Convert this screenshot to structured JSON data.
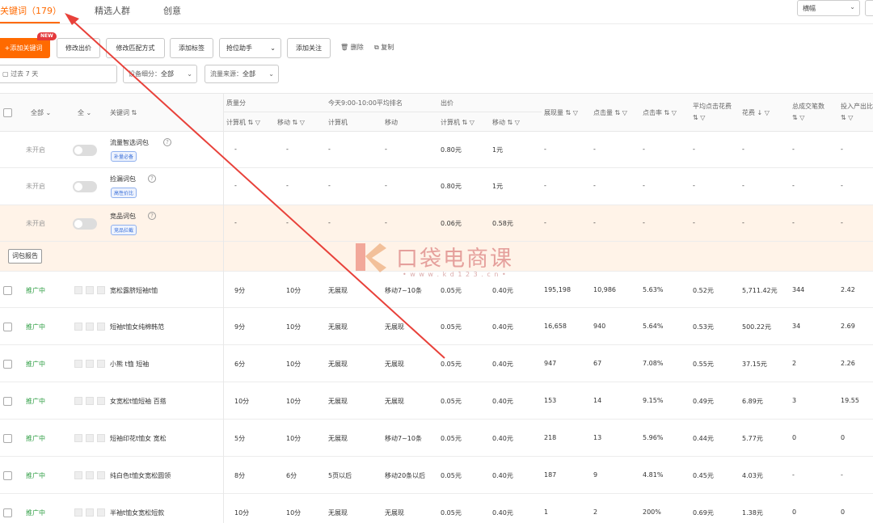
{
  "tabs": [
    {
      "label": "关键词（179）",
      "active": true
    },
    {
      "label": "精选人群",
      "active": false
    },
    {
      "label": "创意",
      "active": false
    }
  ],
  "view_select": {
    "value": "横幅"
  },
  "toolbar": {
    "add_keyword": "+添加关键词",
    "new_badge": "NEW",
    "modify_bid": "修改出价",
    "modify_match": "修改匹配方式",
    "add_tag": "添加标签",
    "rank_helper": "抢位助手",
    "add_follow": "添加关注",
    "delete": "删除",
    "copy": "复制"
  },
  "filters": {
    "date": "过去 7 天",
    "device_label": "设备细分：",
    "device_value": "全部",
    "source_label": "流量来源：",
    "source_value": "全部"
  },
  "headers": {
    "status_filter": "全部",
    "all2": "全",
    "keyword": "关键词 ⇅",
    "quality_group": "质量分",
    "quality_pc": "计算机 ⇅ ▽",
    "quality_mobile": "移动 ⇅ ▽",
    "rank_group": "今天9:00-10:00平均排名",
    "rank_pc": "计算机",
    "rank_mobile": "移动",
    "bid_group": "出价",
    "bid_pc": "计算机 ⇅ ▽",
    "bid_mobile": "移动 ⇅ ▽",
    "impressions": "展现量 ⇅ ▽",
    "clicks": "点击量 ⇅ ▽",
    "ctr": "点击率 ⇅ ▽",
    "avg_cpc_line1": "平均点击花费",
    "avg_cpc_line2": "⇅ ▽",
    "spend": "花费 ↓ ▽",
    "orders_line1": "总成交笔数",
    "orders_line2": "⇅ ▽",
    "roi_line1": "投入产出比",
    "roi_line2": "⇅ ▽"
  },
  "packages": [
    {
      "status": "未开启",
      "name": "流量智选词包",
      "tag": "补量必备",
      "q_pc": "-",
      "q_mob": "-",
      "r_pc": "-",
      "r_mob": "-",
      "bid_pc": "0.80元",
      "bid_mob": "1元",
      "imp": "-",
      "clk": "-",
      "ctr": "-",
      "cpc": "-",
      "spend": "-",
      "orders": "-",
      "roi": "-"
    },
    {
      "status": "未开启",
      "name": "捡漏词包",
      "tag": "高性价比",
      "q_pc": "-",
      "q_mob": "-",
      "r_pc": "-",
      "r_mob": "-",
      "bid_pc": "0.80元",
      "bid_mob": "1元",
      "imp": "-",
      "clk": "-",
      "ctr": "-",
      "cpc": "-",
      "spend": "-",
      "orders": "-",
      "roi": "-"
    },
    {
      "status": "未开启",
      "name": "竞品词包",
      "tag": "竞品拦截",
      "q_pc": "-",
      "q_mob": "-",
      "r_pc": "-",
      "r_mob": "-",
      "bid_pc": "0.06元",
      "bid_mob": "0.58元",
      "imp": "-",
      "clk": "-",
      "ctr": "-",
      "cpc": "-",
      "spend": "-",
      "orders": "-",
      "roi": "-"
    }
  ],
  "report_button": "词包报告",
  "keywords": [
    {
      "status": "推广中",
      "name": "宽松露脐短袖t恤",
      "q_pc": "9分",
      "q_mob": "10分",
      "r_pc": "无展现",
      "r_mob": "移动7~10条",
      "bid_pc": "0.05元",
      "bid_mob": "0.40元",
      "imp": "195,198",
      "clk": "10,986",
      "ctr": "5.63%",
      "cpc": "0.52元",
      "spend": "5,711.42元",
      "orders": "344",
      "roi": "2.42"
    },
    {
      "status": "推广中",
      "name": "短袖t恤女纯棉韩范",
      "q_pc": "9分",
      "q_mob": "10分",
      "r_pc": "无展现",
      "r_mob": "无展现",
      "bid_pc": "0.05元",
      "bid_mob": "0.40元",
      "imp": "16,658",
      "clk": "940",
      "ctr": "5.64%",
      "cpc": "0.53元",
      "spend": "500.22元",
      "orders": "34",
      "roi": "2.69"
    },
    {
      "status": "推广中",
      "name": "小熊 t恤 短袖",
      "q_pc": "6分",
      "q_mob": "10分",
      "r_pc": "无展现",
      "r_mob": "无展现",
      "bid_pc": "0.05元",
      "bid_mob": "0.40元",
      "imp": "947",
      "clk": "67",
      "ctr": "7.08%",
      "cpc": "0.55元",
      "spend": "37.15元",
      "orders": "2",
      "roi": "2.26"
    },
    {
      "status": "推广中",
      "name": "女宽松t恤短袖 百搭",
      "q_pc": "10分",
      "q_mob": "10分",
      "r_pc": "无展现",
      "r_mob": "无展现",
      "bid_pc": "0.05元",
      "bid_mob": "0.40元",
      "imp": "153",
      "clk": "14",
      "ctr": "9.15%",
      "cpc": "0.49元",
      "spend": "6.89元",
      "orders": "3",
      "roi": "19.55"
    },
    {
      "status": "推广中",
      "name": "短袖印花t恤女 宽松",
      "q_pc": "5分",
      "q_mob": "10分",
      "r_pc": "无展现",
      "r_mob": "移动7~10条",
      "bid_pc": "0.05元",
      "bid_mob": "0.40元",
      "imp": "218",
      "clk": "13",
      "ctr": "5.96%",
      "cpc": "0.44元",
      "spend": "5.77元",
      "orders": "0",
      "roi": "0"
    },
    {
      "status": "推广中",
      "name": "纯白色t恤女宽松圆领",
      "q_pc": "8分",
      "q_mob": "6分",
      "r_pc": "5页以后",
      "r_mob": "移动20条以后",
      "bid_pc": "0.05元",
      "bid_mob": "0.40元",
      "imp": "187",
      "clk": "9",
      "ctr": "4.81%",
      "cpc": "0.45元",
      "spend": "4.03元",
      "orders": "-",
      "roi": "-"
    },
    {
      "status": "推广中",
      "name": "半袖t恤女宽松短款",
      "q_pc": "10分",
      "q_mob": "10分",
      "r_pc": "无展现",
      "r_mob": "无展现",
      "bid_pc": "0.05元",
      "bid_mob": "0.40元",
      "imp": "1",
      "clk": "2",
      "ctr": "200%",
      "cpc": "0.69元",
      "spend": "1.38元",
      "orders": "0",
      "roi": "0"
    }
  ],
  "watermark": {
    "brand": "口袋电商课",
    "url": "• w w w . k d 1 2 3 . c n •"
  },
  "colors": {
    "accent": "#ff6a00",
    "active_status": "#2f9e44",
    "package_row_bg": "#fff3e8",
    "arrow": "#e8413a"
  }
}
